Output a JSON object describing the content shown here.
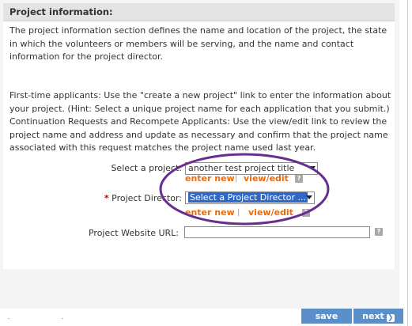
{
  "section": {
    "title": "Project information:"
  },
  "intro": "The project information section defines the name and location of the project, the state in which the volunteers or members will be serving, and the name and contact information for the project director.",
  "instructions": "First-time applicants: Use the \"create a new project\" link to enter the information about your project. (Hint: Select a unique project name for each application that you submit.) Continuation Requests and Recompete Applicants: Use the view/edit link to review the project name and address and update as necessary and confirm that the project name associated with this request matches the project name used last year.",
  "project": {
    "label": "Select a project:",
    "selected": "another test project title",
    "enter_new": "enter new",
    "separator": "|",
    "view_edit": "view/edit",
    "help": "?"
  },
  "director": {
    "required_mark": "*",
    "label": "Project Director:",
    "selected": "Select a Project Director ...",
    "enter_new": "enter new",
    "separator": "|",
    "view_edit": "view/edit",
    "help": "?"
  },
  "website": {
    "label": "Project Website URL:",
    "value": "",
    "help": "?"
  },
  "buttons": {
    "save": "save",
    "next": "next",
    "next_icon": "❯"
  },
  "colors": {
    "header_bg": "#e3e3e3",
    "link": "#e86b0f",
    "button": "#5a8fc9",
    "highlight_oval": "#6a2c91",
    "selection": "#3068c8"
  }
}
